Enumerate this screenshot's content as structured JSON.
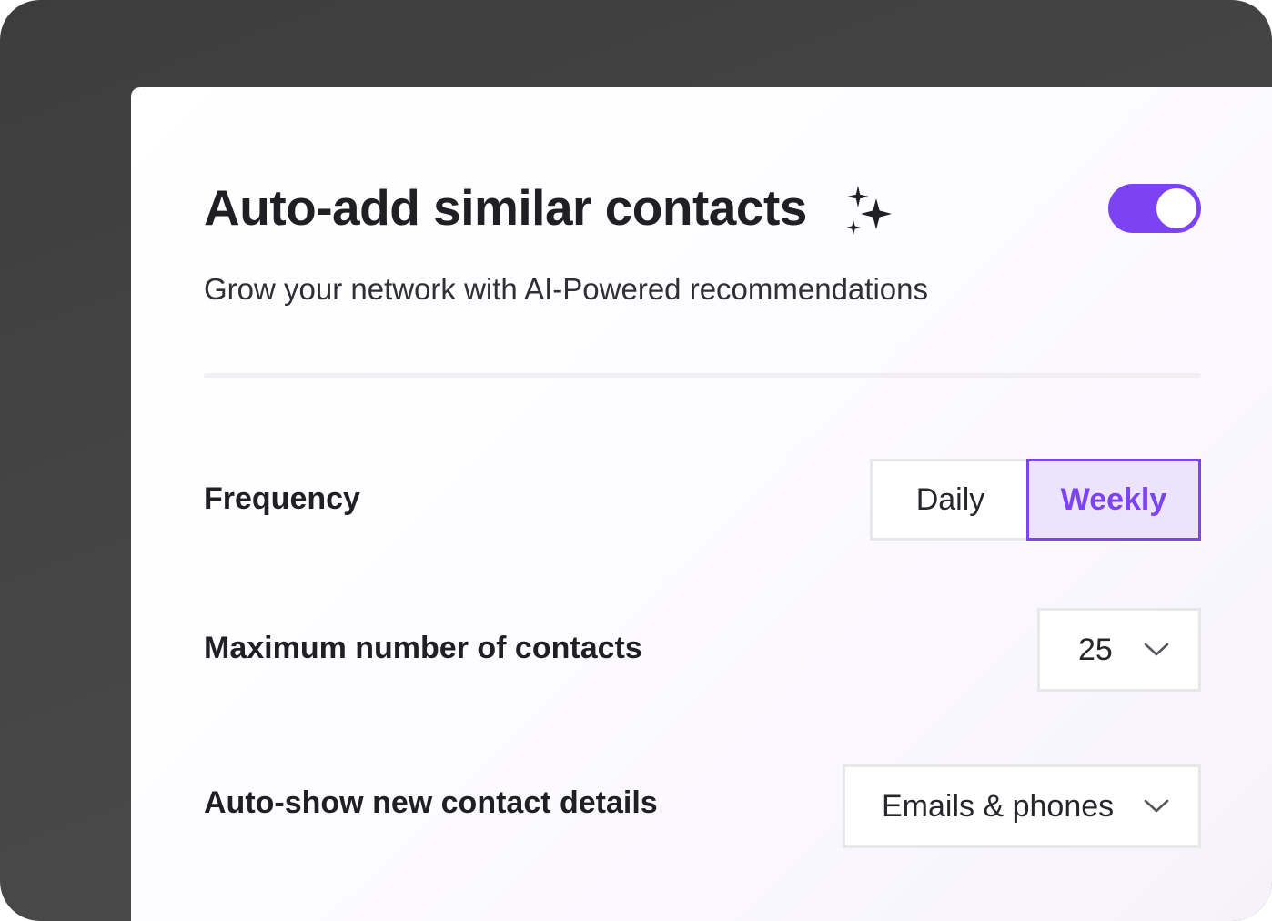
{
  "header": {
    "title": "Auto-add similar contacts",
    "title_icon": "sparkles-icon",
    "subtitle": "Grow your network with AI-Powered recommendations",
    "toggle_enabled": true
  },
  "frequency": {
    "label": "Frequency",
    "options": [
      "Daily",
      "Weekly"
    ],
    "selected": "Weekly"
  },
  "max_contacts": {
    "label": "Maximum number of contacts",
    "value": "25"
  },
  "auto_show": {
    "label": "Auto-show new contact details",
    "value": "Emails & phones"
  },
  "colors": {
    "accent": "#7c43f3",
    "accent_light": "#ece4fd",
    "frame": "#454545",
    "text": "#1f1f24"
  }
}
